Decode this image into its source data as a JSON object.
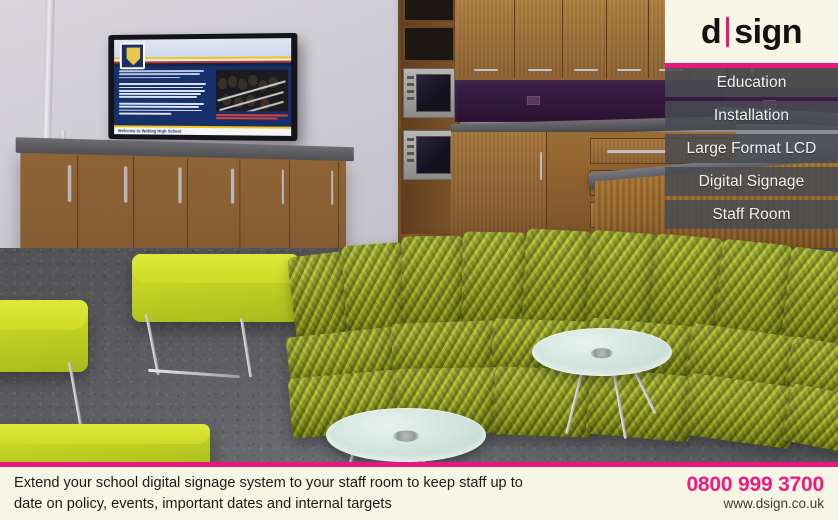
{
  "brand": {
    "logo_prefix": "d",
    "logo_suffix": "sign",
    "logo_divider_color": "#e6187f",
    "accent_color": "#e6187f",
    "panel_bg": "#f7f5e6"
  },
  "nav": {
    "items": [
      {
        "label": "Education"
      },
      {
        "label": "Installation"
      },
      {
        "label": "Large Format LCD"
      },
      {
        "label": "Digital Signage"
      },
      {
        "label": "Staff Room"
      }
    ],
    "item_bg": "rgba(72,76,82,.87)",
    "item_text_color": "#f2f2f2"
  },
  "banner": {
    "copy_line_1": "Extend your school digital signage system to your staff room to keep staff up to",
    "copy_line_2": "date on policy, events, important dates and internal targets",
    "phone": "0800 999 3700",
    "website": "www.dsign.co.uk",
    "phone_color": "#ec1d7c",
    "website_color": "#3b3a36",
    "rule_color": "#e6187f",
    "background": "#f7f5e6"
  },
  "photo": {
    "description": "School staff room with wall-mounted large format LCD displaying digital signage, kitchenette with wood cabinets and purple splashback, curved lime-green modular sofa, lime benches and frosted glass tables on grey carpet",
    "tv": {
      "signage_welcome_text": "Welcome to Woking High School",
      "screen_bg": "#18306a",
      "accent_stripe_colors": [
        "#f0c419",
        "#eef1f7",
        "#c0392b"
      ]
    },
    "colors": {
      "wall": "#d2d0d6",
      "floor_carpet": "#5d5d62",
      "cabinet_wood": "#9a6c3b",
      "worktop": "#55555a",
      "splashback_purple": "#3d1f48",
      "sofa_green": "#b2bf24",
      "bench_lime": "#cddb28",
      "glass_table": "#d5e6e0"
    }
  }
}
